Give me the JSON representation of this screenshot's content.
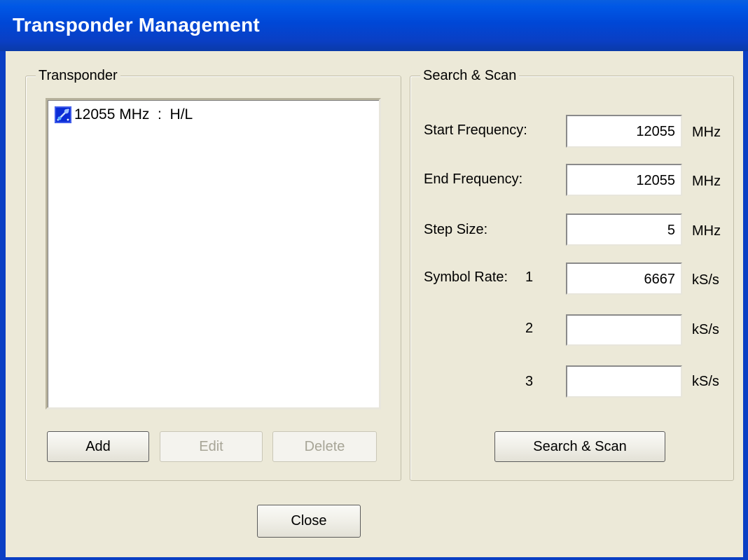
{
  "window": {
    "title": "Transponder Management"
  },
  "transponder": {
    "group_label": "Transponder",
    "items": [
      {
        "icon": "satellite-icon",
        "text": "12055 MHz  :  H/L"
      }
    ],
    "buttons": {
      "add": "Add",
      "edit": "Edit",
      "delete": "Delete"
    }
  },
  "scan": {
    "group_label": "Search & Scan",
    "start_frequency": {
      "label": "Start Frequency:",
      "value": "12055",
      "unit": "MHz"
    },
    "end_frequency": {
      "label": "End Frequency:",
      "value": "12055",
      "unit": "MHz"
    },
    "step_size": {
      "label": "Step Size:",
      "value": "5",
      "unit": "MHz"
    },
    "symbol_rate_label": "Symbol Rate:",
    "symbol_rates": [
      {
        "index": "1",
        "value": "6667",
        "unit": "kS/s"
      },
      {
        "index": "2",
        "value": "",
        "unit": "kS/s"
      },
      {
        "index": "3",
        "value": "",
        "unit": "kS/s"
      }
    ],
    "search_button": "Search & Scan"
  },
  "close_button": "Close",
  "colors": {
    "title_bar": "#0a3fc4",
    "dialog_bg": "#ece9d8",
    "icon_blue": "#0a2cd6"
  }
}
